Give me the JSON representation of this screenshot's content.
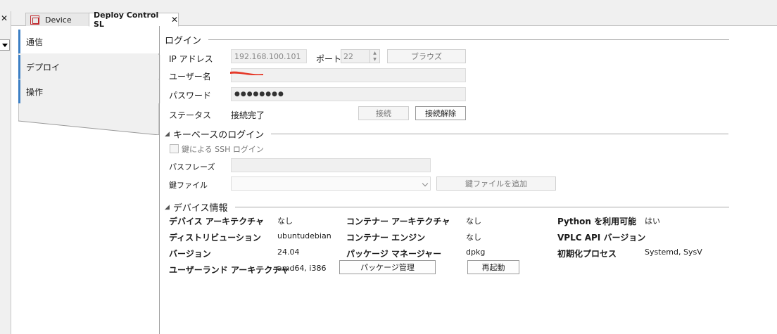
{
  "window": {
    "left_close": "✕",
    "tabs": [
      {
        "label": "Device"
      },
      {
        "label": "Deploy Control SL",
        "close": "✕"
      }
    ]
  },
  "nav": {
    "items": [
      {
        "label": "通信"
      },
      {
        "label": "デプロイ"
      },
      {
        "label": "操作"
      }
    ]
  },
  "login": {
    "title": "ログイン",
    "ip_label": "IP アドレス",
    "ip_value": "192.168.100.101",
    "port_label": "ポート",
    "port_value": "22",
    "browse_button": "ブラウズ",
    "user_label": "ユーザー名",
    "password_label": "パスワード",
    "password_value": "●●●●●●●●",
    "status_label": "ステータス",
    "status_value": "接続完了",
    "connect_button": "接続",
    "disconnect_button": "接続解除"
  },
  "key_login": {
    "title": "キーベースのログイン",
    "ssh_checkbox_label": "鍵による SSH ログイン",
    "passphrase_label": "パスフレーズ",
    "keyfile_label": "鍵ファイル",
    "add_keyfile_button": "鍵ファイルを追加"
  },
  "device_info": {
    "title": "デバイス情報",
    "col1": [
      {
        "label": "デバイス アーキテクチャ",
        "value": "なし"
      },
      {
        "label": "ディストリビューション",
        "value": "ubuntudebian"
      },
      {
        "label": "バージョン",
        "value": "24.04"
      },
      {
        "label": "ユーザーランド アーキテクチャ",
        "value": "amd64, i386"
      }
    ],
    "col2": [
      {
        "label": "コンテナー アーキテクチャ",
        "value": "なし"
      },
      {
        "label": "コンテナー エンジン",
        "value": "なし"
      },
      {
        "label": "パッケージ マネージャー",
        "value": "dpkg"
      }
    ],
    "col3": [
      {
        "label": "Python を利用可能",
        "value": "はい"
      },
      {
        "label": "VPLC API バージョン",
        "value": ""
      },
      {
        "label": "初期化プロセス",
        "value": "Systemd, SysV"
      }
    ],
    "package_button": "パッケージ管理",
    "restart_button": "再起動"
  }
}
